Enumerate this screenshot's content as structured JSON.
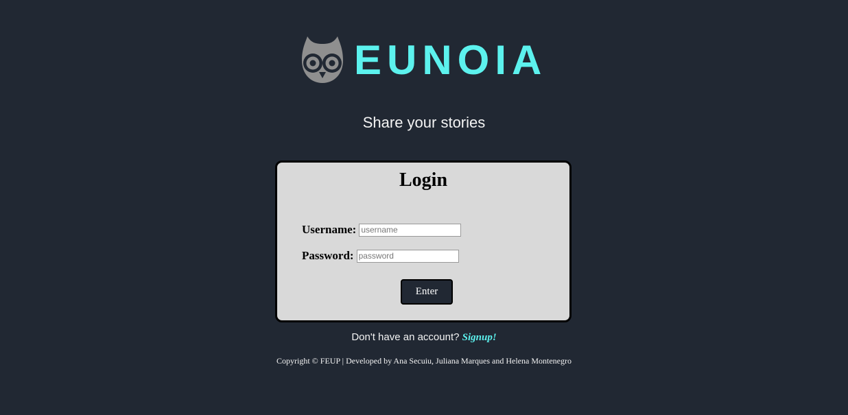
{
  "brand": {
    "name": "EUNOIA",
    "logo_icon": "owl-icon",
    "accent_color": "#5cf2ee"
  },
  "tagline": "Share your stories",
  "login": {
    "title": "Login",
    "username_label": "Username:",
    "username_placeholder": "username",
    "username_value": "",
    "password_label": "Password:",
    "password_placeholder": "password",
    "password_value": "",
    "enter_label": "Enter"
  },
  "signup": {
    "prompt": "Don't have an account?",
    "link_text": "Signup!"
  },
  "footer": {
    "text": "Copyright © FEUP | Developed by Ana Secuiu, Juliana Marques and Helena Montenegro"
  },
  "colors": {
    "background": "#212833",
    "card": "#d9d9d9",
    "button": "#212833"
  }
}
